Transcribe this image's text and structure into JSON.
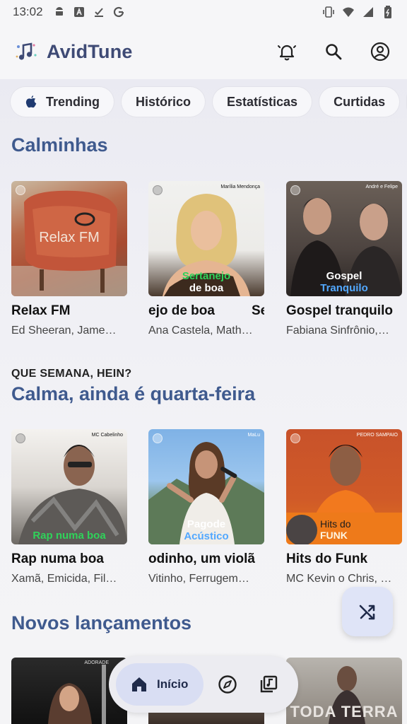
{
  "status_bar": {
    "time": "13:02"
  },
  "app": {
    "title": "AvidTune"
  },
  "chips": [
    {
      "label": "Trending"
    },
    {
      "label": "Histórico"
    },
    {
      "label": "Estatísticas"
    },
    {
      "label": "Curtidas"
    }
  ],
  "sections": {
    "calminhas": {
      "title": "Calminhas",
      "cards": [
        {
          "cover_text": "Relax FM",
          "title": "Relax FM",
          "subtitle": "Ed Sheeran, Jame…"
        },
        {
          "cover_tag": "Marília Mendonça",
          "cover_line1": "Sertanejo",
          "cover_line2": "de boa",
          "title": "ejo de boa",
          "title_tail": "Se",
          "subtitle": "Ana Castela, Math…"
        },
        {
          "cover_tag": "André e Felipe",
          "cover_line1": "Gospel",
          "cover_line2": "Tranquilo",
          "title": "Gospel tranquilo",
          "subtitle": "Fabiana Sinfrônio,…"
        }
      ]
    },
    "quarta": {
      "kicker": "QUE SEMANA, HEIN?",
      "title": "Calma, ainda é quarta-feira",
      "cards": [
        {
          "cover_tag": "MC Cabelinho",
          "cover_text": "Rap numa boa",
          "title": "Rap numa boa",
          "subtitle": "Xamã, Emicida, Fil…"
        },
        {
          "cover_tag": "MaLu",
          "cover_line1": "Pagode",
          "cover_line2": "Acústico",
          "title": "odinho, um violã",
          "subtitle": "Vitinho, Ferrugem…"
        },
        {
          "cover_tag": "PEDRO SAMPAIO",
          "cover_line1": "Hits do",
          "cover_line2": "FUNK",
          "title": "Hits do Funk",
          "subtitle": "MC Kevin o Chris, …"
        }
      ]
    },
    "novos": {
      "title": "Novos lançamentos",
      "cover_tag": "ADORADE",
      "cover_text": "TODA TERRA"
    }
  },
  "bottom_nav": {
    "home_label": "Início"
  },
  "colors": {
    "accent": "#3f5a8e",
    "title": "#3e4a75",
    "green_text": "#2fd35a",
    "blue_text": "#52a8ff"
  },
  "icons": {
    "status": [
      "android-icon",
      "text-icon",
      "download-done-icon",
      "google-icon",
      "vibrate-icon",
      "wifi-icon",
      "signal-icon",
      "battery-icon"
    ],
    "app_bar": [
      "bell-icon",
      "search-icon",
      "account-icon"
    ],
    "fab": "shuffle-icon",
    "nav": [
      "home-icon",
      "explore-icon",
      "library-icon"
    ]
  }
}
